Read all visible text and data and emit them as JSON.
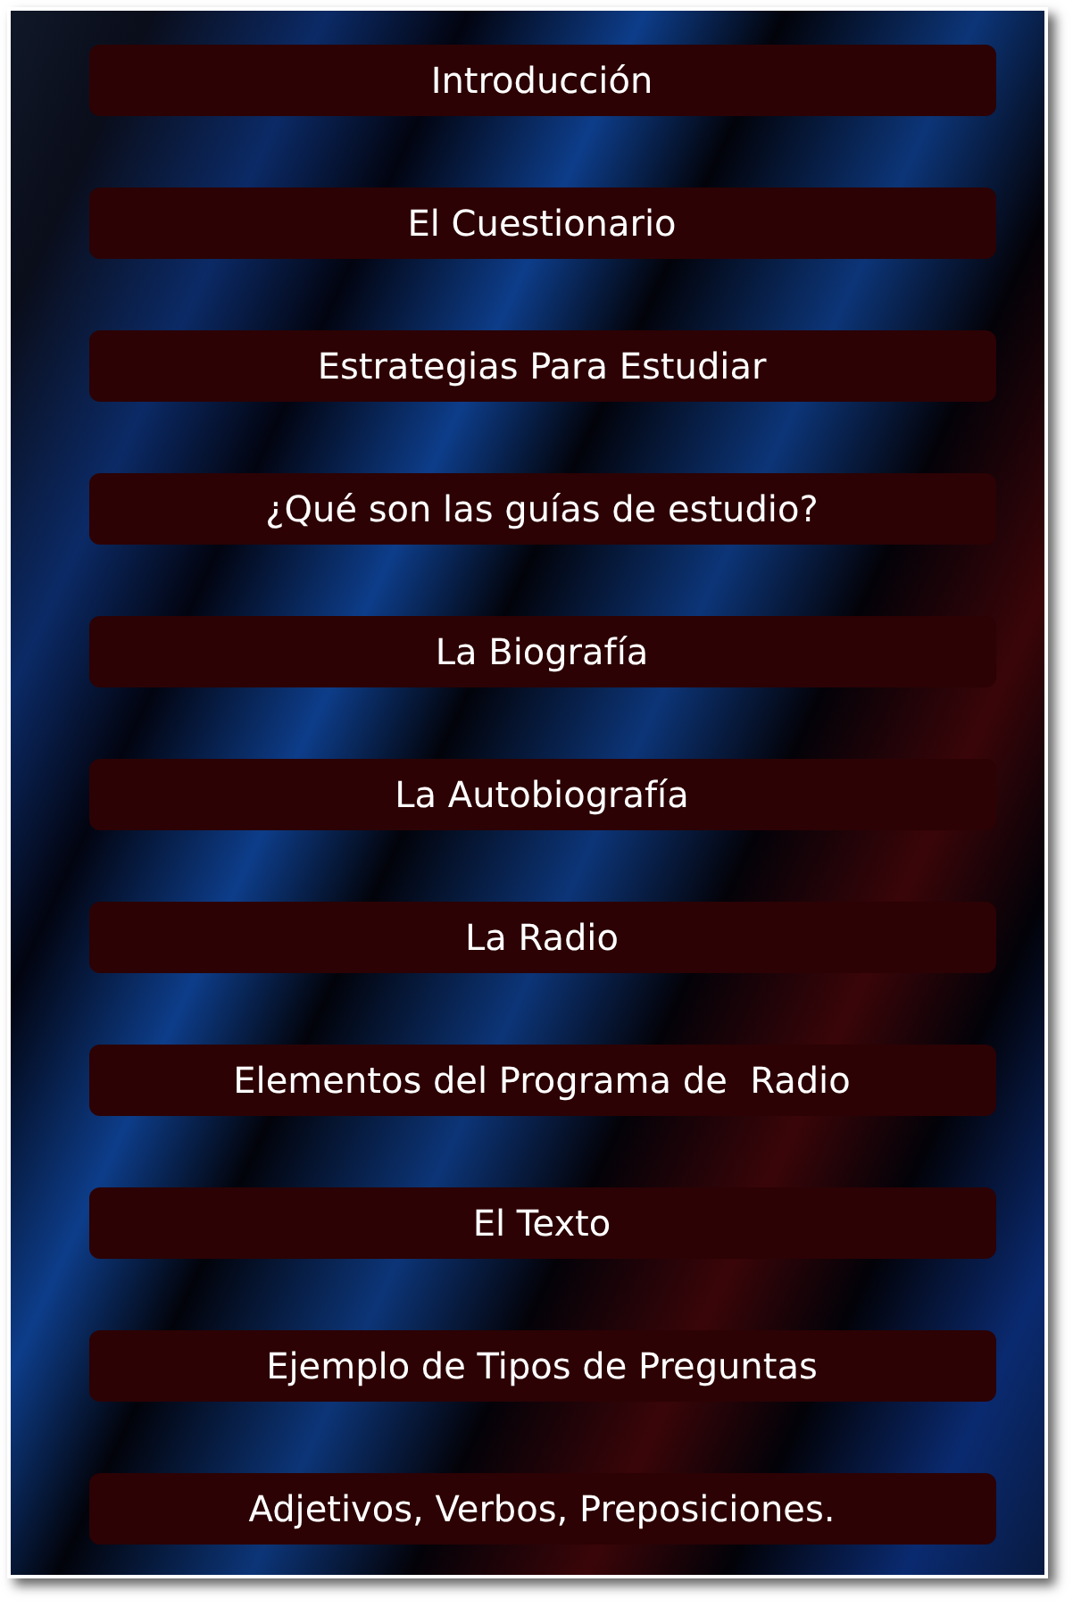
{
  "menu": [
    {
      "label": "Introducción"
    },
    {
      "label": "El Cuestionario"
    },
    {
      "label": "Estrategias Para Estudiar"
    },
    {
      "label": "¿Qué son las guías de estudio?"
    },
    {
      "label": "La Biografía"
    },
    {
      "label": "La Autobiografía"
    },
    {
      "label": "La Radio"
    },
    {
      "label": "Elementos del Programa de  Radio"
    },
    {
      "label": "El Texto"
    },
    {
      "label": "Ejemplo de Tipos de Preguntas"
    },
    {
      "label": "Adjetivos, Verbos, Preposiciones."
    }
  ]
}
